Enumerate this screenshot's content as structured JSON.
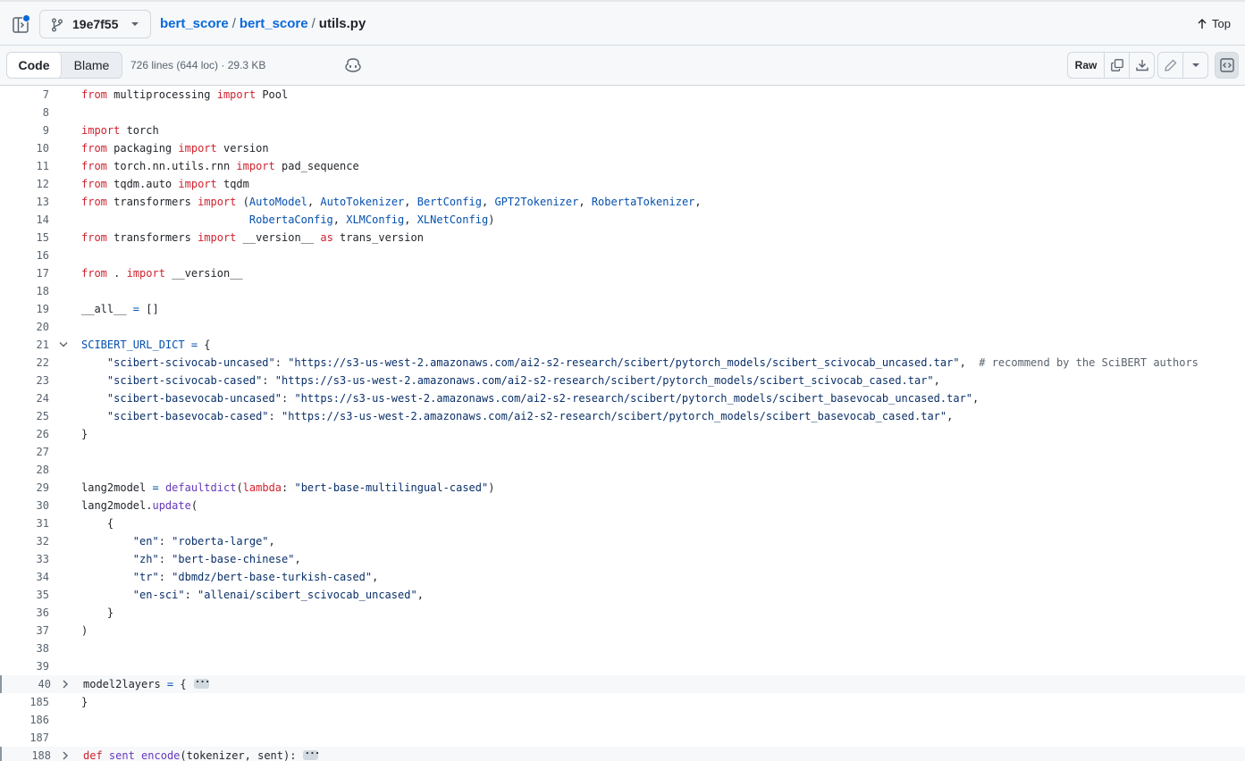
{
  "header": {
    "branch": "19e7f55",
    "breadcrumb": [
      "bert_score",
      "bert_score"
    ],
    "file_name": "utils.py",
    "top_label": "Top"
  },
  "toolbar": {
    "code_tab": "Code",
    "blame_tab": "Blame",
    "file_info": "726 lines (644 loc) · 29.3 KB",
    "raw_label": "Raw"
  },
  "colors": {
    "keyword": "#cf222e",
    "string": "#0a3069",
    "constant": "#0550ae",
    "function": "#6639ba",
    "comment": "#59636e",
    "text": "#1f2328"
  },
  "code_lines": [
    {
      "n": "7",
      "tokens": [
        [
          "k",
          "from"
        ],
        [
          "t",
          " multiprocessing "
        ],
        [
          "k",
          "import"
        ],
        [
          "t",
          " Pool"
        ]
      ]
    },
    {
      "n": "8",
      "tokens": []
    },
    {
      "n": "9",
      "tokens": [
        [
          "k",
          "import"
        ],
        [
          "t",
          " torch"
        ]
      ]
    },
    {
      "n": "10",
      "tokens": [
        [
          "k",
          "from"
        ],
        [
          "t",
          " packaging "
        ],
        [
          "k",
          "import"
        ],
        [
          "t",
          " version"
        ]
      ]
    },
    {
      "n": "11",
      "tokens": [
        [
          "k",
          "from"
        ],
        [
          "t",
          " torch.nn.utils.rnn "
        ],
        [
          "k",
          "import"
        ],
        [
          "t",
          " pad_sequence"
        ]
      ]
    },
    {
      "n": "12",
      "tokens": [
        [
          "k",
          "from"
        ],
        [
          "t",
          " tqdm.auto "
        ],
        [
          "k",
          "import"
        ],
        [
          "t",
          " tqdm"
        ]
      ]
    },
    {
      "n": "13",
      "tokens": [
        [
          "k",
          "from"
        ],
        [
          "t",
          " transformers "
        ],
        [
          "k",
          "import"
        ],
        [
          "t",
          " ("
        ],
        [
          "c",
          "AutoModel"
        ],
        [
          "t",
          ", "
        ],
        [
          "c",
          "AutoTokenizer"
        ],
        [
          "t",
          ", "
        ],
        [
          "c",
          "BertConfig"
        ],
        [
          "t",
          ", "
        ],
        [
          "c",
          "GPT2Tokenizer"
        ],
        [
          "t",
          ", "
        ],
        [
          "c",
          "RobertaTokenizer"
        ],
        [
          "t",
          ","
        ]
      ]
    },
    {
      "n": "14",
      "tokens": [
        [
          "t",
          "                          "
        ],
        [
          "c",
          "RobertaConfig"
        ],
        [
          "t",
          ", "
        ],
        [
          "c",
          "XLMConfig"
        ],
        [
          "t",
          ", "
        ],
        [
          "c",
          "XLNetConfig"
        ],
        [
          "t",
          ")"
        ]
      ]
    },
    {
      "n": "15",
      "tokens": [
        [
          "k",
          "from"
        ],
        [
          "t",
          " transformers "
        ],
        [
          "k",
          "import"
        ],
        [
          "t",
          " __version__ "
        ],
        [
          "k",
          "as"
        ],
        [
          "t",
          " trans_version"
        ]
      ]
    },
    {
      "n": "16",
      "tokens": []
    },
    {
      "n": "17",
      "tokens": [
        [
          "k",
          "from"
        ],
        [
          "t",
          " . "
        ],
        [
          "k",
          "import"
        ],
        [
          "t",
          " __version__"
        ]
      ]
    },
    {
      "n": "18",
      "tokens": []
    },
    {
      "n": "19",
      "tokens": [
        [
          "t",
          "__all__ "
        ],
        [
          "c",
          "="
        ],
        [
          "t",
          " []"
        ]
      ]
    },
    {
      "n": "20",
      "tokens": []
    },
    {
      "n": "21",
      "fold": "open",
      "tokens": [
        [
          "c",
          "SCIBERT_URL_DICT"
        ],
        [
          "t",
          " "
        ],
        [
          "c",
          "="
        ],
        [
          "t",
          " {"
        ]
      ]
    },
    {
      "n": "22",
      "tokens": [
        [
          "t",
          "    "
        ],
        [
          "s",
          "\"scibert-scivocab-uncased\""
        ],
        [
          "t",
          ": "
        ],
        [
          "s",
          "\"https://s3-us-west-2.amazonaws.com/ai2-s2-research/scibert/pytorch_models/scibert_scivocab_uncased.tar\""
        ],
        [
          "t",
          ",  "
        ],
        [
          "m",
          "# recommend by the SciBERT authors"
        ]
      ]
    },
    {
      "n": "23",
      "tokens": [
        [
          "t",
          "    "
        ],
        [
          "s",
          "\"scibert-scivocab-cased\""
        ],
        [
          "t",
          ": "
        ],
        [
          "s",
          "\"https://s3-us-west-2.amazonaws.com/ai2-s2-research/scibert/pytorch_models/scibert_scivocab_cased.tar\""
        ],
        [
          "t",
          ","
        ]
      ]
    },
    {
      "n": "24",
      "tokens": [
        [
          "t",
          "    "
        ],
        [
          "s",
          "\"scibert-basevocab-uncased\""
        ],
        [
          "t",
          ": "
        ],
        [
          "s",
          "\"https://s3-us-west-2.amazonaws.com/ai2-s2-research/scibert/pytorch_models/scibert_basevocab_uncased.tar\""
        ],
        [
          "t",
          ","
        ]
      ]
    },
    {
      "n": "25",
      "tokens": [
        [
          "t",
          "    "
        ],
        [
          "s",
          "\"scibert-basevocab-cased\""
        ],
        [
          "t",
          ": "
        ],
        [
          "s",
          "\"https://s3-us-west-2.amazonaws.com/ai2-s2-research/scibert/pytorch_models/scibert_basevocab_cased.tar\""
        ],
        [
          "t",
          ","
        ]
      ]
    },
    {
      "n": "26",
      "tokens": [
        [
          "t",
          "}"
        ]
      ]
    },
    {
      "n": "27",
      "tokens": []
    },
    {
      "n": "28",
      "tokens": []
    },
    {
      "n": "29",
      "tokens": [
        [
          "t",
          "lang2model "
        ],
        [
          "c",
          "="
        ],
        [
          "t",
          " "
        ],
        [
          "f",
          "defaultdict"
        ],
        [
          "t",
          "("
        ],
        [
          "k",
          "lambda"
        ],
        [
          "t",
          ": "
        ],
        [
          "s",
          "\"bert-base-multilingual-cased\""
        ],
        [
          "t",
          ")"
        ]
      ]
    },
    {
      "n": "30",
      "tokens": [
        [
          "t",
          "lang2model."
        ],
        [
          "f",
          "update"
        ],
        [
          "t",
          "("
        ]
      ]
    },
    {
      "n": "31",
      "tokens": [
        [
          "t",
          "    {"
        ]
      ]
    },
    {
      "n": "32",
      "tokens": [
        [
          "t",
          "        "
        ],
        [
          "s",
          "\"en\""
        ],
        [
          "t",
          ": "
        ],
        [
          "s",
          "\"roberta-large\""
        ],
        [
          "t",
          ","
        ]
      ]
    },
    {
      "n": "33",
      "tokens": [
        [
          "t",
          "        "
        ],
        [
          "s",
          "\"zh\""
        ],
        [
          "t",
          ": "
        ],
        [
          "s",
          "\"bert-base-chinese\""
        ],
        [
          "t",
          ","
        ]
      ]
    },
    {
      "n": "34",
      "tokens": [
        [
          "t",
          "        "
        ],
        [
          "s",
          "\"tr\""
        ],
        [
          "t",
          ": "
        ],
        [
          "s",
          "\"dbmdz/bert-base-turkish-cased\""
        ],
        [
          "t",
          ","
        ]
      ]
    },
    {
      "n": "35",
      "tokens": [
        [
          "t",
          "        "
        ],
        [
          "s",
          "\"en-sci\""
        ],
        [
          "t",
          ": "
        ],
        [
          "s",
          "\"allenai/scibert_scivocab_uncased\""
        ],
        [
          "t",
          ","
        ]
      ]
    },
    {
      "n": "36",
      "tokens": [
        [
          "t",
          "    }"
        ]
      ]
    },
    {
      "n": "37",
      "tokens": [
        [
          "t",
          ")"
        ]
      ]
    },
    {
      "n": "38",
      "tokens": []
    },
    {
      "n": "39",
      "tokens": []
    },
    {
      "n": "40",
      "fold": "closed",
      "highlight": true,
      "ellipsis": true,
      "tokens": [
        [
          "t",
          "model2layers "
        ],
        [
          "c",
          "="
        ],
        [
          "t",
          " {"
        ]
      ]
    },
    {
      "n": "185",
      "tokens": [
        [
          "t",
          "}"
        ]
      ]
    },
    {
      "n": "186",
      "tokens": []
    },
    {
      "n": "187",
      "tokens": []
    },
    {
      "n": "188",
      "fold": "closed",
      "highlight": true,
      "ellipsis": true,
      "tokens": [
        [
          "k",
          "def"
        ],
        [
          "t",
          " "
        ],
        [
          "f",
          "sent_encode"
        ],
        [
          "t",
          "(tokenizer, sent):"
        ]
      ]
    }
  ]
}
